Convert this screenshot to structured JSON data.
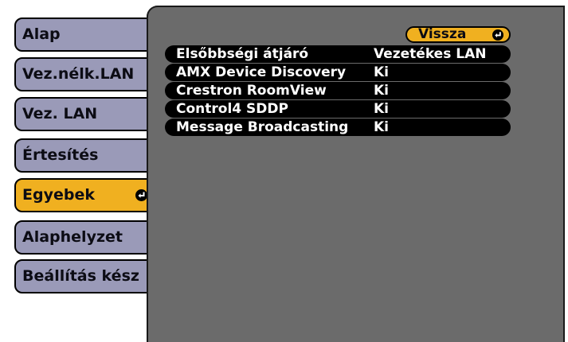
{
  "menu": {
    "items": [
      {
        "label": "Alap",
        "selected": false
      },
      {
        "label": "Vez.nélk.LAN",
        "selected": false
      },
      {
        "label": "Vez. LAN",
        "selected": false
      },
      {
        "label": "Értesítés",
        "selected": false
      },
      {
        "label": "Egyebek",
        "selected": true
      },
      {
        "label": "Alaphelyzet",
        "selected": false
      },
      {
        "label": "Beállítás kész",
        "selected": false
      }
    ]
  },
  "panel": {
    "back_label": "Vissza",
    "rows": [
      {
        "label": "Elsőbbségi átjáró",
        "value": "Vezetékes LAN"
      },
      {
        "label": "AMX Device Discovery",
        "value": "Ki"
      },
      {
        "label": "Crestron RoomView",
        "value": "Ki"
      },
      {
        "label": "Control4 SDDP",
        "value": "Ki"
      },
      {
        "label": "Message Broadcasting",
        "value": "Ki"
      }
    ]
  },
  "colors": {
    "menu_item": "#9a9ab8",
    "selected": "#f0b020",
    "panel": "#6b6b6b",
    "row": "#000000"
  },
  "icons": {
    "enter": "enter-icon"
  }
}
